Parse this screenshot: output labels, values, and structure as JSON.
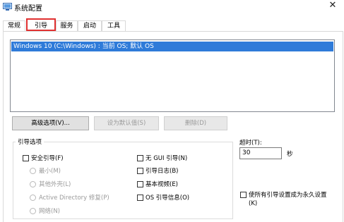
{
  "window": {
    "title": "系统配置",
    "close_glyph": "✕"
  },
  "tabs": [
    {
      "label": "常规",
      "active": false
    },
    {
      "label": "引导",
      "active": true
    },
    {
      "label": "服务",
      "active": false
    },
    {
      "label": "启动",
      "active": false
    },
    {
      "label": "工具",
      "active": false
    }
  ],
  "os_list": {
    "items": [
      "Windows 10 (C:\\Windows) : 当前 OS; 默认 OS"
    ]
  },
  "buttons": {
    "advanced": "高级选项(V)...",
    "set_default": "设为默认值(S)",
    "delete": "删除(D)"
  },
  "boot_options": {
    "legend": "引导选项",
    "safe_boot": "安全引导(F)",
    "minimal": "最小(M)",
    "alternate_shell": "其他外壳(L)",
    "active_directory": "Active Directory 修复(P)",
    "network": "网络(N)",
    "no_gui_boot": "无 GUI 引导(N)",
    "boot_log": "引导日志(B)",
    "base_video": "基本视频(E)",
    "os_boot_info": "OS 引导信息(O)"
  },
  "timeout": {
    "label": "超时(T):",
    "value": "30",
    "unit": "秒"
  },
  "permanent": {
    "line1": "使所有引导设置成为永久设置",
    "line2": "(K)"
  },
  "colors": {
    "selection": "#2f7bd9",
    "tab_highlight": "#e03030"
  }
}
